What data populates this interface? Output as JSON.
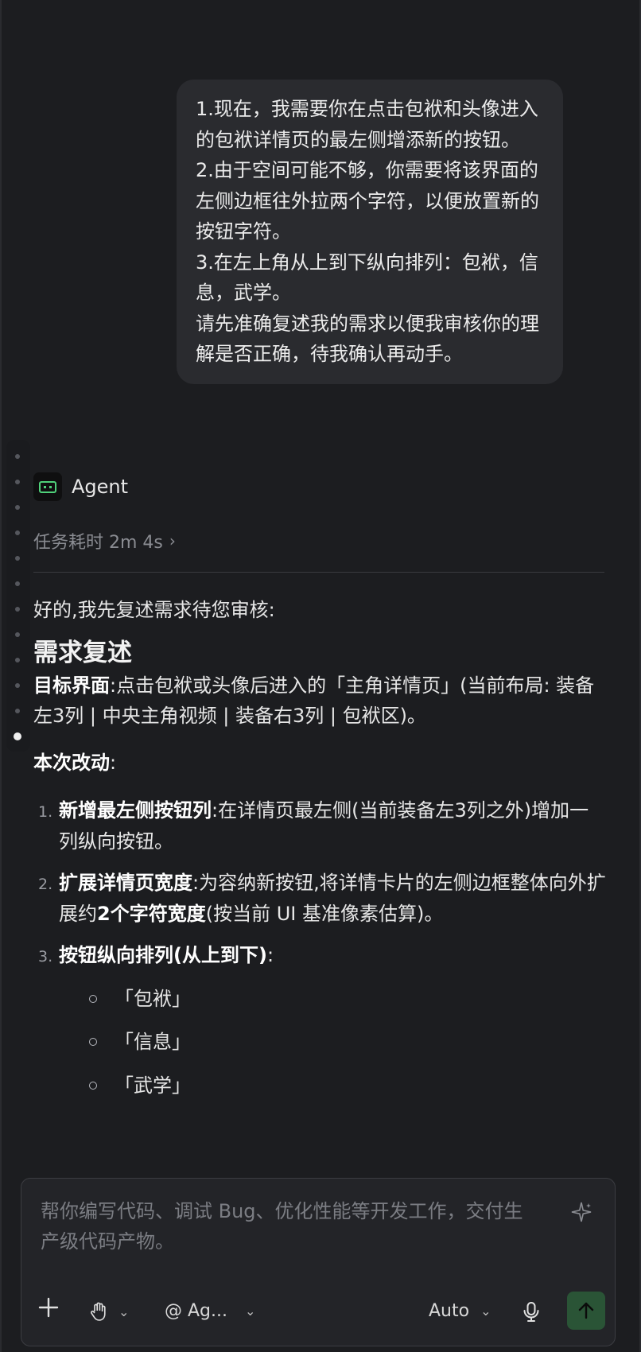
{
  "user_message": {
    "lines": [
      "1.现在，我需要你在点击包袱和头像进入的包袱详情页的最左侧增添新的按钮。",
      "2.由于空间可能不够，你需要将该界面的左侧边框往外拉两个字符，以便放置新的按钮字符。",
      "3.在左上角从上到下纵向排列：包袱，信息，武学。",
      "请先准确复述我的需求以便我审核你的理解是否正确，待我确认再动手。"
    ]
  },
  "timeline": {
    "dot_count": 12,
    "active_index": 11
  },
  "agent": {
    "name": "Agent",
    "duration_label": "任务耗时 2m 4s",
    "intro": "好的,我先复述需求待您审核:",
    "heading": "需求复述",
    "target_label": "目标界面",
    "target_text": ":点击包袱或头像后进入的「主角详情页」(当前布局: 装备左3列 | 中央主角视频 | 装备右3列 | 包袱区)。",
    "changes_label": "本次改动",
    "changes_colon": ":",
    "items": [
      {
        "num": "1.",
        "bold": "新增最左侧按钮列",
        "text": ":在详情页最左侧(当前装备左3列之外)增加一列纵向按钮。"
      },
      {
        "num": "2.",
        "bold": "扩展详情页宽度",
        "text": ":为容纳新按钮,将详情卡片的左侧边框整体向外扩展约",
        "bold2": "2个字符宽度",
        "text2": "(按当前 UI 基准像素估算)。"
      },
      {
        "num": "3.",
        "bold": "按钮纵向排列(从上到下)",
        "text": ":"
      }
    ],
    "sub_items": [
      "「包袱」",
      "「信息」",
      "「武学」"
    ]
  },
  "composer": {
    "placeholder": "帮你编写代码、调试 Bug、优化性能等开发工作，交付生产级代码产物。",
    "agent_selector": "@ Ag...",
    "model_selector": "Auto"
  }
}
